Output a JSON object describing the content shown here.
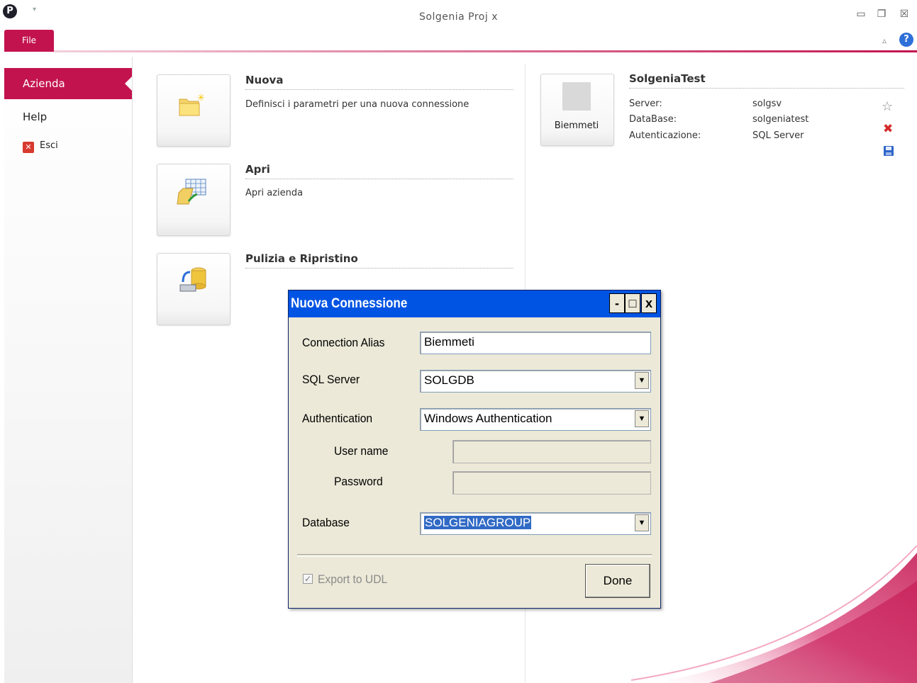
{
  "window": {
    "title": "Solgenia Proj x",
    "logo_letter": "P",
    "qat_arrow": "▾",
    "min_icon": "▭",
    "restore_icon": "❐",
    "close_icon": "☒"
  },
  "ribbon": {
    "file_tab": "File",
    "collapse_icon": "▵",
    "help_icon": "?"
  },
  "nav": {
    "items": [
      {
        "label": "Azienda",
        "selected": true
      },
      {
        "label": "Help"
      },
      {
        "label": "Esci",
        "icon": "exit-icon"
      }
    ]
  },
  "sections": [
    {
      "title": "Nuova",
      "description": "Definisci i parametri per una nuova connessione",
      "icon": "new-folder-icon"
    },
    {
      "title": "Apri",
      "description": "Apri azienda",
      "icon": "open-folder-icon"
    },
    {
      "title": "Pulizia e Ripristino",
      "description": "",
      "icon": "database-restore-icon"
    }
  ],
  "connection": {
    "tile_label": "Biemmeti",
    "name": "SolgeniaTest",
    "fields": [
      {
        "key": "Server:",
        "value": "solgsv"
      },
      {
        "key": "DataBase:",
        "value": "solgeniatest"
      },
      {
        "key": "Autenticazione:",
        "value": "SQL Server"
      }
    ],
    "actions": [
      "favorite-star-icon",
      "delete-icon",
      "save-icon"
    ]
  },
  "dialog": {
    "title": "Nuova Connessione",
    "buttons": {
      "minimize": "-",
      "maximize": "□",
      "close": "x"
    },
    "alias_label": "Connection Alias",
    "alias_value": "Biemmeti",
    "server_label": "SQL Server",
    "server_value": "SOLGDB",
    "auth_label": "Authentication",
    "auth_value": "Windows Authentication",
    "username_label": "User name",
    "username_value": "",
    "password_label": "Password",
    "password_value": "",
    "database_label": "Database",
    "database_value": "SOLGENIAGROUP",
    "export_label": "Export to UDL",
    "export_checked": true,
    "done_label": "Done"
  },
  "colors": {
    "accent": "#c3134e",
    "dialog_title": "#0054e3",
    "dialog_bg": "#ece9d8"
  }
}
